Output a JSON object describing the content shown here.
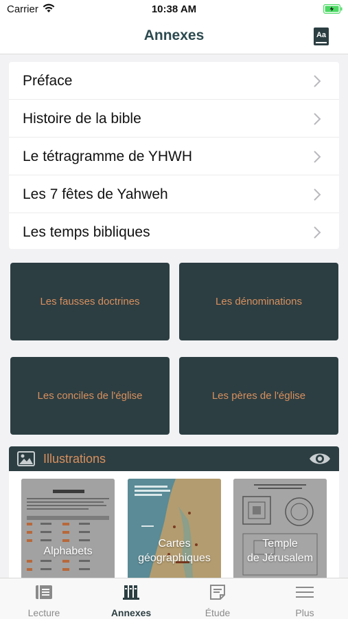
{
  "status": {
    "carrier": "Carrier",
    "time": "10:38 AM"
  },
  "header": {
    "title": "Annexes",
    "font_icon_text": "Aa"
  },
  "list": [
    {
      "label": "Préface"
    },
    {
      "label": "Histoire de la bible"
    },
    {
      "label": "Le tétragramme de YHWH"
    },
    {
      "label": "Les 7 fêtes de Yahweh"
    },
    {
      "label": "Les temps bibliques"
    }
  ],
  "tiles": [
    {
      "label": "Les fausses doctrines"
    },
    {
      "label": "Les dénominations"
    },
    {
      "label": "Les conciles de l'église"
    },
    {
      "label": "Les pères de l'église"
    }
  ],
  "illustrations": {
    "title": "Illustrations",
    "items": [
      {
        "label": "Alphabets"
      },
      {
        "label_line1": "Cartes",
        "label_line2": "géographiques"
      },
      {
        "label_line1": "Temple",
        "label_line2": "de Jérusalem"
      }
    ]
  },
  "tabbar": [
    {
      "label": "Lecture",
      "icon": "book-icon"
    },
    {
      "label": "Annexes",
      "icon": "library-icon"
    },
    {
      "label": "Étude",
      "icon": "note-icon"
    },
    {
      "label": "Plus",
      "icon": "menu-icon"
    }
  ],
  "colors": {
    "accent_dark": "#2c3e42",
    "accent_orange": "#d9905e",
    "battery_green": "#4cd964"
  }
}
